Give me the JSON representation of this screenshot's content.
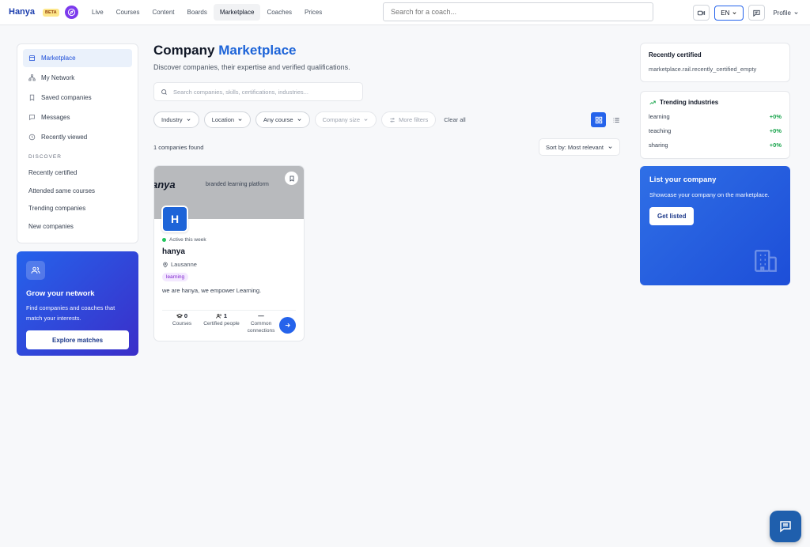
{
  "header": {
    "logo": "Hanya",
    "beta": "BETA",
    "nav": [
      "Live",
      "Courses",
      "Content",
      "Boards",
      "Marketplace",
      "Coaches",
      "Prices"
    ],
    "search_placeholder": "Search for a coach...",
    "language": "EN",
    "profile": "Profile"
  },
  "sidebar": {
    "items": [
      "Marketplace",
      "My Network",
      "Saved companies",
      "Messages",
      "Recently viewed"
    ],
    "discover_title": "DISCOVER",
    "discover_items": [
      "Recently certified",
      "Attended same courses",
      "Trending companies",
      "New companies"
    ]
  },
  "grow": {
    "title": "Grow your network",
    "text": "Find companies and coaches that match your interests.",
    "button": "Explore matches"
  },
  "main": {
    "title_part1": "Company",
    "title_part2": "Marketplace",
    "subtitle": "Discover companies, their expertise and verified qualifications.",
    "search_placeholder": "Search companies, skills, certifications, industries...",
    "filters": [
      "Industry",
      "Location",
      "Any course",
      "Company size",
      "More filters"
    ],
    "clear_all": "Clear all",
    "count": "1 companies found",
    "sort": "Sort by: Most relevant"
  },
  "card": {
    "banner_logo": "anya",
    "banner_tag": "branded learning platform",
    "avatar_letter": "H",
    "activity": "Active this week",
    "name": "hanya",
    "location": "Lausanne",
    "tag": "learning",
    "description": "we are hanya, we empower Learning.",
    "stats": [
      {
        "value": "0",
        "label": "Courses"
      },
      {
        "value": "1",
        "label": "Certified people"
      },
      {
        "value": "—",
        "label": "Common connections"
      }
    ]
  },
  "right": {
    "recent_title": "Recently certified",
    "recent_empty": "marketplace.rail.recently_certified_empty",
    "trending_title": "Trending industries",
    "trending": [
      {
        "name": "learning",
        "change": "+0%"
      },
      {
        "name": "teaching",
        "change": "+0%"
      },
      {
        "name": "sharing",
        "change": "+0%"
      }
    ],
    "list_title": "List your company",
    "list_text": "Showcase your company on the marketplace.",
    "list_button": "Get listed"
  }
}
